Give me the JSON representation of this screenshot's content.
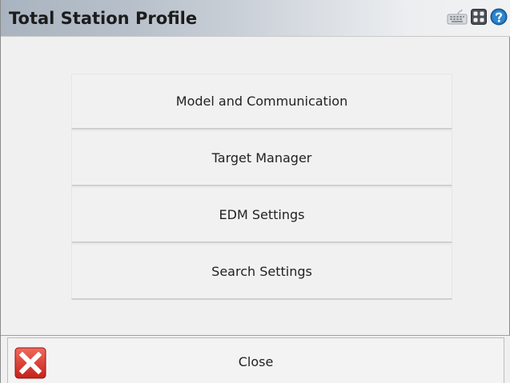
{
  "window": {
    "title": "Total Station Profile"
  },
  "title_icons": [
    "keyboard-icon",
    "grid-icon",
    "help-icon"
  ],
  "menu": {
    "items": [
      {
        "label": "Model and Communication"
      },
      {
        "label": "Target Manager"
      },
      {
        "label": "EDM Settings"
      },
      {
        "label": "Search Settings"
      }
    ]
  },
  "footer": {
    "close_label": "Close",
    "close_icon": "close-x-icon"
  },
  "colors": {
    "close_red": "#d9302a",
    "help_blue": "#1f6fb5"
  }
}
